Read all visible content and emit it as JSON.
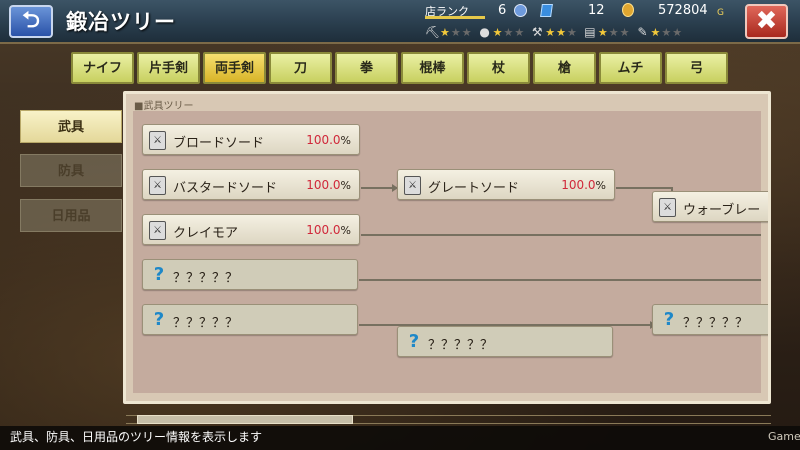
{
  "header": {
    "title": "鍛冶ツリー",
    "back_icon": "⮌",
    "close_icon": "✖",
    "shop_rank_label": "店ランク",
    "shop_rank_value": "6",
    "crystal_value": "12",
    "gold_value": "572804",
    "gold_unit": "G",
    "skills": [
      {
        "icon_name": "pickaxe-icon",
        "glyph": "⛏",
        "stars": 1
      },
      {
        "icon_name": "ore-icon",
        "glyph": "●",
        "stars": 1
      },
      {
        "icon_name": "hammer-icon",
        "glyph": "⚒",
        "stars": 2
      },
      {
        "icon_name": "book-icon",
        "glyph": "▤",
        "stars": 1
      },
      {
        "icon_name": "scroll-icon",
        "glyph": "✎",
        "stars": 1
      }
    ]
  },
  "category_tabs": [
    "ナイフ",
    "片手剣",
    "両手剣",
    "刀",
    "拳",
    "棍棒",
    "杖",
    "槍",
    "ムチ",
    "弓"
  ],
  "active_category": "両手剣",
  "side_tabs": [
    {
      "label": "武具",
      "active": true
    },
    {
      "label": "防具",
      "active": false
    },
    {
      "label": "日用品",
      "active": false
    }
  ],
  "panel": {
    "label": "■武具ツリー",
    "nodes": [
      {
        "name": "ブロードソード",
        "percent": "100.0",
        "unit": "%",
        "known": true
      },
      {
        "name": "バスタードソード",
        "percent": "100.0",
        "unit": "%",
        "known": true
      },
      {
        "name": "グレートソード",
        "percent": "100.0",
        "unit": "%",
        "known": true
      },
      {
        "name": "ウォーブレー",
        "percent": "",
        "unit": "",
        "known": true
      },
      {
        "name": "クレイモア",
        "percent": "100.0",
        "unit": "%",
        "known": true
      },
      {
        "name": "？？？？？",
        "percent": "",
        "unit": "",
        "known": false
      },
      {
        "name": "？？？？？",
        "percent": "",
        "unit": "",
        "known": false
      },
      {
        "name": "？？？？？",
        "percent": "",
        "unit": "",
        "known": false
      },
      {
        "name": "？？？？？",
        "percent": "",
        "unit": "",
        "known": false
      }
    ]
  },
  "footer": {
    "help_text": "武具、防具、日用品のツリー情報を表示します",
    "watermark": "Gamer"
  },
  "colors": {
    "header_bg": "#2a3e4e",
    "tab_bg": "#c8d060",
    "tab_active_bg": "#d8b428",
    "percent_color": "#d0283a",
    "unknown_icon_color": "#1e88c8"
  }
}
